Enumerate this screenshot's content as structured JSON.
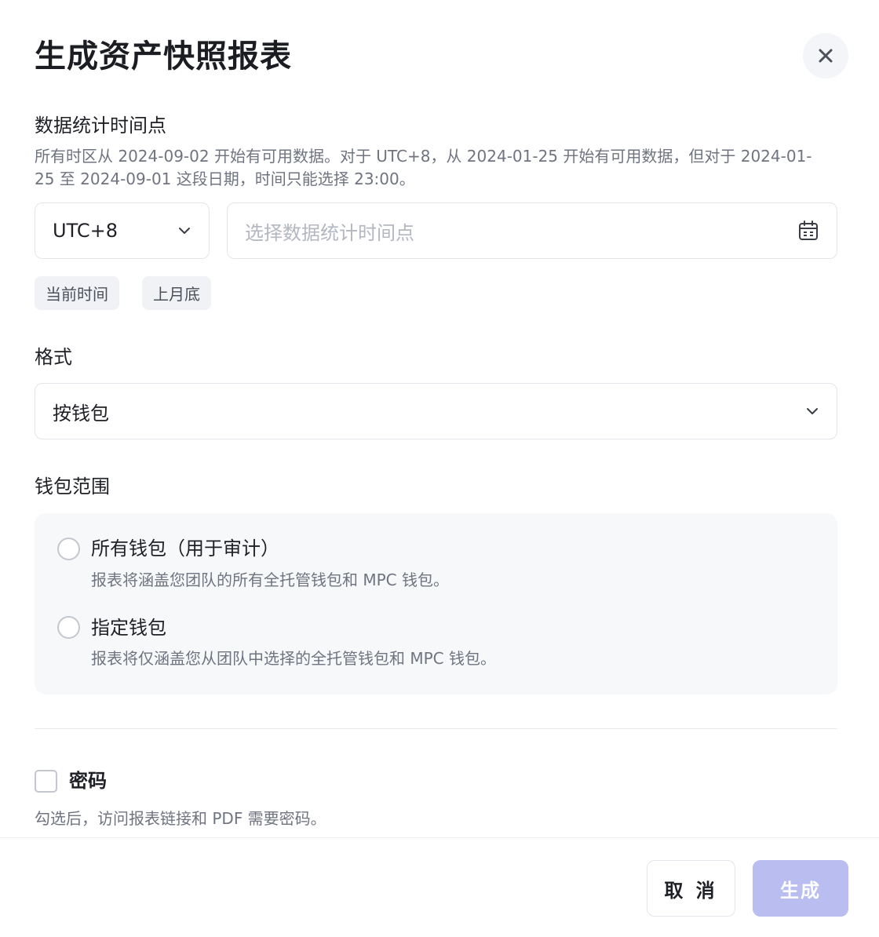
{
  "modal": {
    "title": "生成资产快照报表"
  },
  "stat_time": {
    "label": "数据统计时间点",
    "hint": "所有时区从 2024-09-02 开始有可用数据。对于 UTC+8，从 2024-01-25 开始有可用数据，但对于 2024-01-25 至 2024-09-01 这段日期，时间只能选择 23:00。",
    "timezone_value": "UTC+8",
    "datetime_placeholder": "选择数据统计时间点",
    "quick_options": [
      "当前时间",
      "上月底"
    ]
  },
  "format": {
    "label": "格式",
    "value": "按钱包"
  },
  "wallet_scope": {
    "label": "钱包范围",
    "options": [
      {
        "title": "所有钱包（用于审计）",
        "desc": "报表将涵盖您团队的所有全托管钱包和 MPC 钱包。"
      },
      {
        "title": "指定钱包",
        "desc": "报表将仅涵盖您从团队中选择的全托管钱包和 MPC 钱包。"
      }
    ]
  },
  "password": {
    "label": "密码",
    "hint": "勾选后，访问报表链接和 PDF 需要密码。"
  },
  "footer": {
    "cancel_label": "取 消",
    "generate_label": "生成"
  },
  "colors": {
    "primary_disabled": "#b9bdf0",
    "border": "#e3e5ea",
    "muted_text": "#6f7480"
  }
}
